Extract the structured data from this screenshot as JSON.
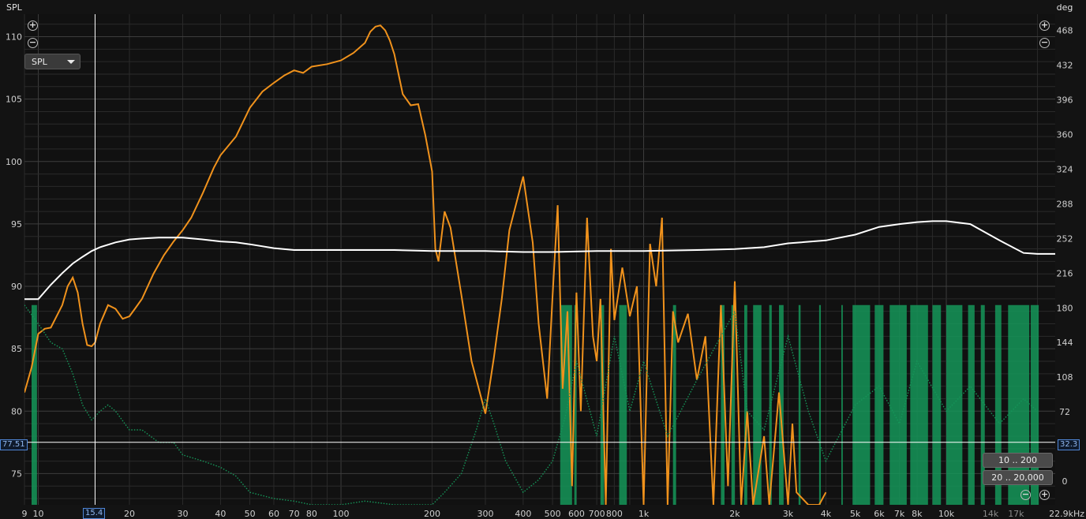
{
  "axes": {
    "left_title": "SPL",
    "right_title": "deg",
    "x_unit_label": "22.9kHz"
  },
  "controls": {
    "measurement_select": "SPL",
    "zoom_in_icon": "zoom-in-icon",
    "zoom_out_icon": "zoom-out-icon",
    "range_low": "10 .. 200",
    "range_full": "20 .. 20,000"
  },
  "cursor": {
    "freq_label": "15.4",
    "level_label": "77.51",
    "right_label": "32.3"
  },
  "colors": {
    "spl": "#f0921c",
    "phase": "#ffffff",
    "distortion_fill": "#159659",
    "distortion_dotted": "#159659"
  },
  "chart_data": {
    "type": "line",
    "x_scale": "log",
    "xlim": [
      9,
      22900
    ],
    "x_ticks": [
      9,
      10,
      20,
      30,
      40,
      50,
      60,
      70,
      80,
      100,
      200,
      300,
      400,
      500,
      600,
      700,
      800,
      1000,
      2000,
      3000,
      4000,
      5000,
      6000,
      7000,
      8000,
      10000,
      14000,
      17000
    ],
    "x_tick_labels": [
      "9",
      "10",
      "20",
      "30",
      "40",
      "50",
      "60",
      "70",
      "80",
      "100",
      "200",
      "300",
      "400",
      "500",
      "600",
      "700",
      "800",
      "1k",
      "2k",
      "3k",
      "4k",
      "5k",
      "6k",
      "7k",
      "8k",
      "10k",
      "14k",
      "17k"
    ],
    "x_tick_labels_dim": [
      "14k",
      "17k"
    ],
    "ylabel": "SPL",
    "y_ticks": [
      75,
      80,
      85,
      90,
      95,
      100,
      105,
      110
    ],
    "ylim": [
      72.5,
      111.8
    ],
    "y2label": "deg",
    "y2_ticks": [
      0,
      36,
      72,
      108,
      144,
      180,
      216,
      252,
      288,
      324,
      360,
      396,
      432,
      468
    ],
    "y2lim": [
      -24.6,
      485
    ],
    "grid": true,
    "series": [
      {
        "name": "SPL",
        "axis": "left",
        "style": "solid",
        "x": [
          9,
          9.5,
          10,
          10.5,
          11,
          12,
          12.5,
          13,
          13.5,
          14,
          14.5,
          15,
          15.4,
          16,
          17,
          18,
          19,
          20,
          21,
          22,
          24,
          26,
          28,
          30,
          32,
          35,
          38,
          40,
          45,
          50,
          55,
          60,
          65,
          70,
          75,
          80,
          90,
          100,
          110,
          120,
          125,
          130,
          135,
          140,
          145,
          150,
          160,
          170,
          180,
          190,
          200,
          205,
          210,
          220,
          230,
          250,
          270,
          300,
          320,
          340,
          360,
          400,
          430,
          450,
          480,
          500,
          520,
          540,
          560,
          580,
          600,
          620,
          650,
          680,
          700,
          720,
          750,
          780,
          800,
          850,
          900,
          950,
          1000,
          1050,
          1100,
          1150,
          1200,
          1250,
          1300,
          1400,
          1500,
          1600,
          1700,
          1800,
          1900,
          2000,
          2100,
          2200,
          2300,
          2500,
          2600,
          2800,
          3000,
          3100,
          3200,
          3500,
          3800,
          4000
        ],
        "y": [
          81.5,
          83.5,
          86.2,
          86.6,
          86.7,
          88.5,
          90.0,
          90.7,
          89.5,
          87.0,
          85.3,
          85.2,
          85.5,
          87.0,
          88.5,
          88.2,
          87.4,
          87.6,
          88.3,
          89.0,
          91.0,
          92.5,
          93.6,
          94.5,
          95.5,
          97.5,
          99.5,
          100.5,
          102.0,
          104.3,
          105.6,
          106.3,
          106.9,
          107.3,
          107.1,
          107.6,
          107.8,
          108.1,
          108.7,
          109.5,
          110.4,
          110.8,
          110.9,
          110.5,
          109.7,
          108.6,
          105.4,
          104.5,
          104.6,
          102.1,
          99.2,
          93.0,
          92.0,
          96.0,
          94.7,
          89.3,
          84.0,
          79.8,
          84.3,
          89.0,
          94.5,
          98.8,
          93.5,
          87.0,
          81.0,
          89.2,
          96.5,
          81.8,
          88.0,
          74.0,
          89.5,
          80.0,
          95.5,
          86.0,
          84.0,
          89.0,
          72.5,
          93.0,
          87.3,
          91.5,
          87.6,
          90.0,
          72.5,
          93.4,
          90.0,
          95.5,
          72.5,
          88.0,
          85.5,
          87.8,
          82.5,
          86.0,
          72.5,
          88.5,
          74.0,
          90.4,
          72.5,
          80.0,
          72.5,
          78.0,
          72.5,
          81.5,
          72.5,
          79.0,
          73.5,
          72.5,
          72.5,
          73.5
        ]
      },
      {
        "name": "Phase",
        "axis": "right",
        "style": "dotted-solid",
        "x": [
          9,
          10,
          11,
          12,
          13,
          14,
          15,
          16,
          18,
          20,
          22,
          25,
          28,
          30,
          35,
          40,
          45,
          50,
          60,
          70,
          80,
          100,
          150,
          200,
          300,
          400,
          500,
          700,
          1000,
          1500,
          2000,
          2500,
          3000,
          4000,
          5000,
          6000,
          7000,
          8000,
          9000,
          10000,
          12000,
          15000,
          18000,
          20000,
          22900
        ],
        "y": [
          189,
          189,
          204,
          216,
          226,
          233,
          239,
          243,
          248,
          251,
          252,
          253,
          253,
          253,
          251,
          249,
          248,
          246,
          242,
          240,
          240,
          240,
          240,
          239,
          239,
          238,
          238,
          239,
          239,
          240,
          241,
          243,
          247,
          250,
          256,
          264,
          267,
          269,
          270,
          270,
          267,
          250,
          237,
          236,
          236
        ]
      },
      {
        "name": "Distortion",
        "axis": "left",
        "style": "dotted",
        "x": [
          9,
          10,
          11,
          12,
          13,
          14,
          15,
          16,
          17,
          18,
          20,
          22,
          25,
          28,
          30,
          35,
          40,
          45,
          50,
          60,
          70,
          80,
          90,
          100,
          120,
          150,
          200,
          220,
          250,
          280,
          300,
          320,
          350,
          400,
          450,
          500,
          550,
          600,
          700,
          800,
          900,
          1000,
          1200,
          1500,
          1800,
          2000,
          2200,
          2500,
          3000,
          3500,
          4000,
          5000,
          6000,
          7000,
          8000,
          10000,
          12000,
          15000,
          18000,
          20000
        ],
        "y": [
          88.5,
          87.0,
          85.5,
          85.0,
          83.0,
          80.5,
          79.3,
          80.0,
          80.5,
          80.0,
          78.5,
          78.5,
          77.5,
          77.5,
          76.5,
          76.0,
          75.5,
          74.8,
          73.5,
          73.0,
          72.8,
          72.5,
          72.5,
          72.5,
          72.8,
          72.5,
          72.5,
          73.5,
          75.0,
          78.5,
          81.0,
          79.0,
          76.0,
          73.5,
          74.5,
          76.0,
          79.5,
          84.0,
          78.0,
          86.0,
          80.0,
          84.0,
          78.0,
          82.5,
          86.0,
          88.0,
          80.0,
          78.5,
          86.0,
          80.0,
          76.0,
          80.5,
          82.0,
          79.0,
          84.0,
          80.0,
          82.0,
          79.0,
          81.0,
          80.0
        ]
      }
    ],
    "distortion_bands": [
      {
        "from": 9.5,
        "to": 9.9,
        "top": 88.5
      },
      {
        "from": 530,
        "to": 580,
        "top": 88.5
      },
      {
        "from": 590,
        "to": 600,
        "top": 88.5
      },
      {
        "from": 720,
        "to": 740,
        "top": 88.5
      },
      {
        "from": 830,
        "to": 880,
        "top": 88.5
      },
      {
        "from": 1250,
        "to": 1280,
        "top": 88.5
      },
      {
        "from": 1800,
        "to": 1850,
        "top": 88.5
      },
      {
        "from": 1950,
        "to": 2000,
        "top": 88.5
      },
      {
        "from": 2150,
        "to": 2200,
        "top": 88.5
      },
      {
        "from": 2300,
        "to": 2450,
        "top": 88.5
      },
      {
        "from": 2600,
        "to": 2650,
        "top": 88.5
      },
      {
        "from": 2800,
        "to": 2900,
        "top": 88.5
      },
      {
        "from": 3250,
        "to": 3300,
        "top": 88.5
      },
      {
        "from": 3800,
        "to": 3850,
        "top": 88.5
      },
      {
        "from": 4500,
        "to": 4550,
        "top": 88.5
      },
      {
        "from": 4900,
        "to": 5600,
        "top": 88.5
      },
      {
        "from": 5800,
        "to": 6200,
        "top": 88.5
      },
      {
        "from": 6500,
        "to": 7400,
        "top": 88.5
      },
      {
        "from": 7600,
        "to": 8700,
        "top": 88.5
      },
      {
        "from": 9000,
        "to": 9600,
        "top": 88.5
      },
      {
        "from": 10000,
        "to": 11300,
        "top": 88.5
      },
      {
        "from": 11800,
        "to": 12400,
        "top": 88.5
      },
      {
        "from": 13000,
        "to": 13400,
        "top": 88.5
      },
      {
        "from": 14500,
        "to": 15200,
        "top": 88.5
      },
      {
        "from": 16000,
        "to": 18800,
        "top": 88.5
      },
      {
        "from": 19000,
        "to": 20200,
        "top": 88.5
      }
    ]
  }
}
